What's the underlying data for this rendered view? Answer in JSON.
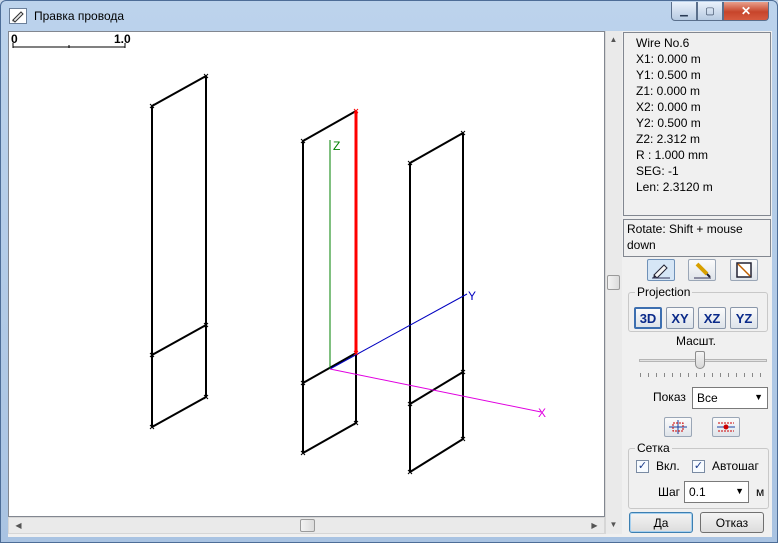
{
  "window": {
    "title": "Правка провода"
  },
  "scale_bar": {
    "left_label": "0",
    "right_label": "1.0"
  },
  "axes": {
    "z_label": "Z",
    "y_label": "Y",
    "x_label": "X"
  },
  "wire_info": {
    "lines": [
      "Wire No.6",
      "X1: 0.000 m",
      "Y1: 0.500 m",
      "Z1: 0.000 m",
      "X2: 0.000 m",
      "Y2: 0.500 m",
      "Z2: 2.312 m",
      "R : 1.000 mm",
      "SEG: -1",
      "Len: 2.3120 m"
    ]
  },
  "hint": "Rotate: Shift + mouse down",
  "projection": {
    "label": "Projection",
    "buttons": [
      "3D",
      "XY",
      "XZ",
      "YZ"
    ],
    "selected": "3D"
  },
  "scale": {
    "label": "Масшт.",
    "level": 0.45
  },
  "show": {
    "label": "Показ",
    "value": "Все"
  },
  "grid": {
    "label": "Сетка",
    "on_label": "Вкл.",
    "on_checked": true,
    "auto_label": "Автошаг",
    "auto_checked": true,
    "step_label": "Шаг",
    "step_value": "0.1",
    "unit": "м"
  },
  "buttons": {
    "ok": "Да",
    "cancel": "Отказ"
  },
  "icons": {
    "title": "pencil-icon",
    "tool1": "edit-wire-icon",
    "tool2": "pen-icon",
    "tool3": "box-icon"
  },
  "colors": {
    "selected_wire": "#ff0000",
    "z_axis": "#008000",
    "y_axis": "#0000c0",
    "x_axis": "#e000e0"
  }
}
